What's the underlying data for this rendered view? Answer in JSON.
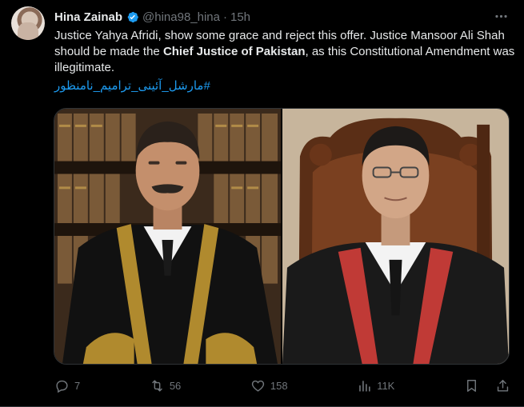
{
  "author": {
    "display_name": "Hina Zainab",
    "handle": "@hina98_hina",
    "separator": "·",
    "time": "15h"
  },
  "tweet": {
    "text_part1": "Justice Yahya Afridi, show some grace and reject this offer. Justice Mansoor Ali Shah should be made the ",
    "text_bold": "Chief Justice of Pakistan",
    "text_part2": ", as this Constitutional Amendment was illegitimate.",
    "hashtag": "#مارشل_آئینی_ترامیم_نامنظور"
  },
  "actions": {
    "replies": "7",
    "reposts": "56",
    "likes": "158",
    "views": "11K"
  },
  "colors": {
    "background": "#000000",
    "text": "#e7e9ea",
    "muted": "#71767b",
    "link": "#1d9bf0",
    "verified": "#1d9bf0"
  }
}
